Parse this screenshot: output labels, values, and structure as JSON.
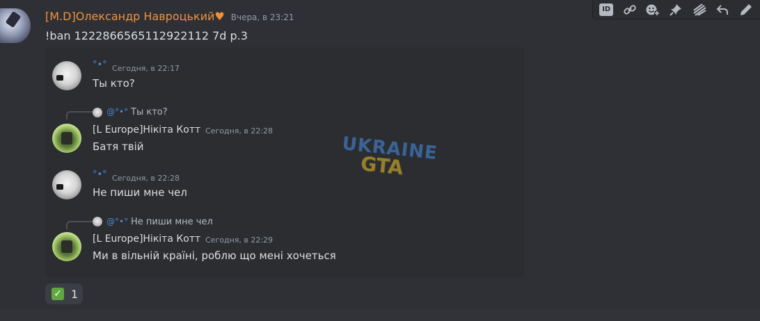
{
  "message": {
    "author": "[M.D]Олександр Навроцький♥",
    "timestamp": "Вчера, в 23:21",
    "content": "!ban 1222866565112922112 7d p.3"
  },
  "embed": {
    "watermark": {
      "line1": "UKRAINE",
      "line2": "GTA"
    },
    "messages": [
      {
        "user": "°•°",
        "time": "Сегодня, в 22:17",
        "text": "Ты кто?",
        "avatar": "cat-avatar"
      },
      {
        "reply": {
          "user": "@°•°",
          "text": "Ты кто?"
        },
        "user": "[L Europe]Нікіта Котт",
        "time": "Сегодня, в 22:28",
        "text": "Батя твій",
        "avatar": "plant-avatar"
      },
      {
        "user": "°•°",
        "time": "Сегодня, в 22:28",
        "text": "Не пиши мне чел",
        "avatar": "cat-avatar"
      },
      {
        "reply": {
          "user": "@°•°",
          "text": "Не пиши мне чел"
        },
        "user": "[L Europe]Нікіта Котт",
        "time": "Сегодня, в 22:29",
        "text": "Ми в вільній країні, роблю що мені хочеться",
        "avatar": "plant-avatar"
      }
    ]
  },
  "reaction": {
    "emoji": "✓",
    "emoji_name": "white-check-mark",
    "count": "1"
  },
  "toolbar": {
    "icons": [
      "id-icon",
      "link-icon",
      "emoji-icon",
      "pin-icon",
      "thread-icon",
      "reply-icon",
      "edit-icon"
    ],
    "id_label": "ID"
  },
  "colors": {
    "background": "#2e3035",
    "author_name": "#f0913a",
    "timestamp": "#949ba4",
    "mention": "#4e86d6",
    "embed_bg": "#2b2d31"
  }
}
